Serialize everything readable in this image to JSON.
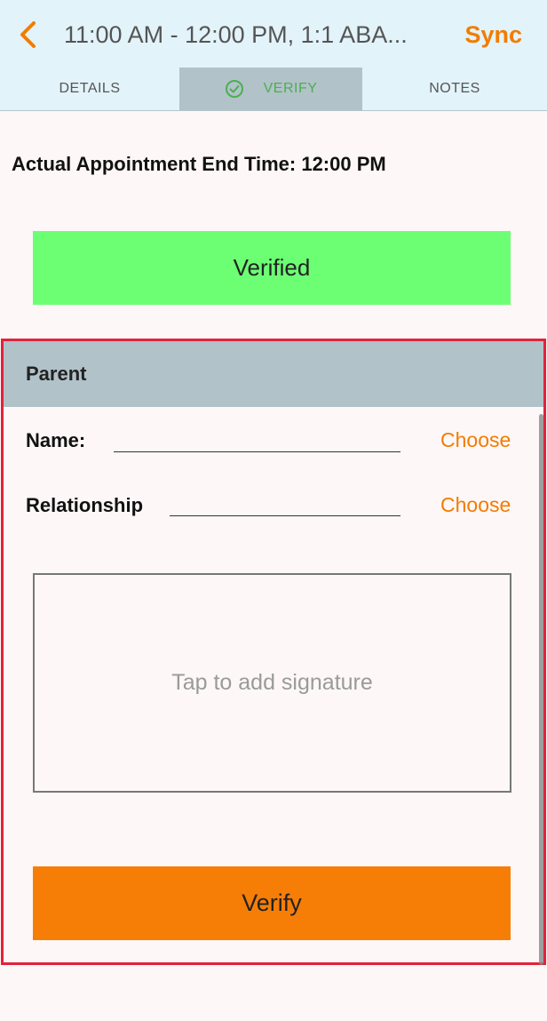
{
  "header": {
    "title": "11:00 AM - 12:00 PM, 1:1 ABA...",
    "sync_label": "Sync",
    "back_icon": "chevron-left-icon"
  },
  "tabs": [
    {
      "label": "DETAILS",
      "active": false
    },
    {
      "label": "VERIFY",
      "active": true,
      "icon": "check-circle-icon"
    },
    {
      "label": "NOTES",
      "active": false
    }
  ],
  "end_time": {
    "text": "Actual Appointment End Time: 12:00 PM"
  },
  "status_banner": {
    "label": "Verified",
    "color": "#6cff74"
  },
  "parent_section": {
    "title": "Parent",
    "name_label": "Name:",
    "name_value": "",
    "name_choose": "Choose",
    "relationship_label": "Relationship",
    "relationship_value": "",
    "relationship_choose": "Choose",
    "signature_placeholder": "Tap to add signature",
    "verify_label": "Verify"
  },
  "colors": {
    "accent": "#f27c00",
    "header_bg": "#e2f3fa",
    "active_tab_bg": "#b1c2c9",
    "verify_button": "#f67e07",
    "highlight_border": "#e2223b"
  }
}
